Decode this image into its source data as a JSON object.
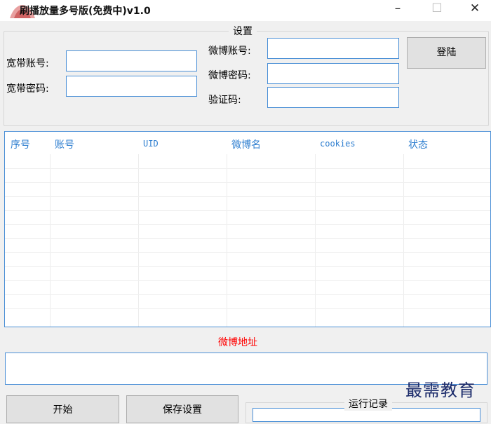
{
  "window": {
    "title": "刷播放量多号版(免费中)v1.0",
    "minimize_glyph": "–",
    "maximize_glyph": "☐",
    "close_glyph": "✕"
  },
  "settings": {
    "legend": "设置",
    "broadband_account_label": "宽带账号:",
    "broadband_account_value": "",
    "broadband_password_label": "宽带密码:",
    "broadband_password_value": "",
    "weibo_account_label": "微博账号:",
    "weibo_account_value": "",
    "weibo_password_label": "微博密码:",
    "weibo_password_value": "",
    "captcha_label": "验证码:",
    "captcha_value": "",
    "login_label": "登陆"
  },
  "table": {
    "columns": [
      "序号",
      "账号",
      "UID",
      "微博名",
      "cookies",
      "状态"
    ],
    "rows": []
  },
  "weibo_url": {
    "label": "微博地址",
    "value": ""
  },
  "footer": {
    "start_label": "开始",
    "save_label": "保存设置",
    "log_label": "运行记录"
  },
  "watermark": "最需教育",
  "colors": {
    "accent_border": "#4a8fd6",
    "header_text": "#2f7fd0",
    "url_label": "#ff0000"
  },
  "icons": {
    "app": "app-logo-icon"
  }
}
